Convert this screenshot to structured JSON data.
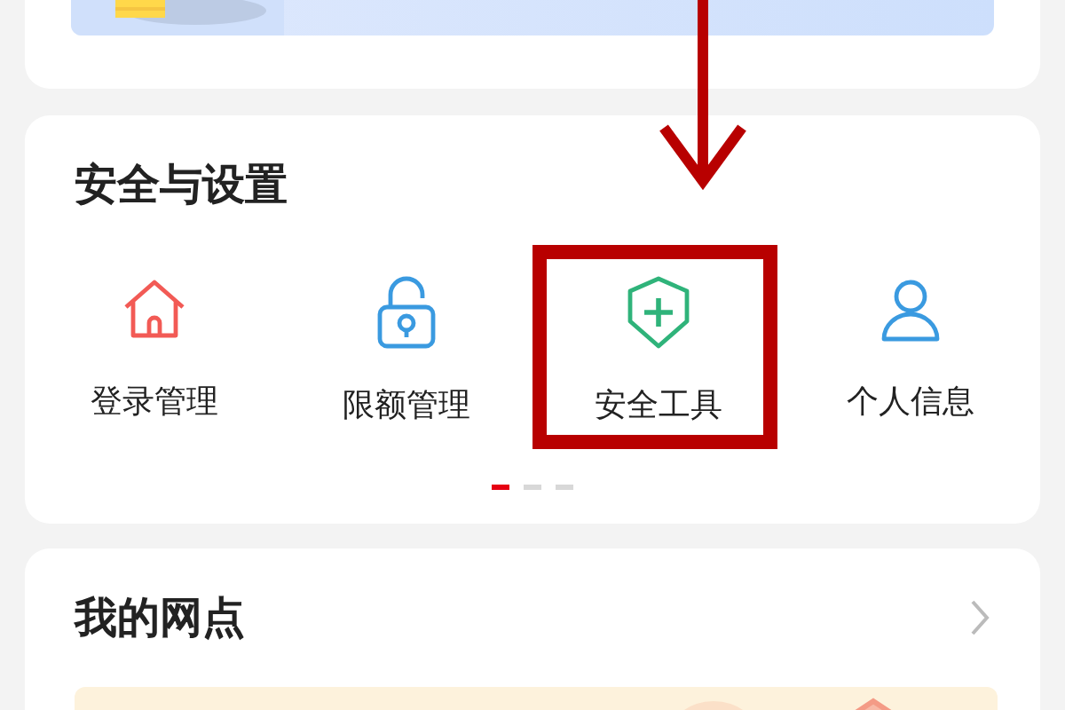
{
  "security_section": {
    "title": "安全与设置",
    "items": [
      {
        "label": "登录管理",
        "kind": "home",
        "highlighted": false
      },
      {
        "label": "限额管理",
        "kind": "lock",
        "highlighted": false
      },
      {
        "label": "安全工具",
        "kind": "shield",
        "highlighted": true
      },
      {
        "label": "个人信息",
        "kind": "user",
        "highlighted": false
      }
    ],
    "pages": [
      {
        "selected": true
      },
      {
        "selected": false
      },
      {
        "selected": false
      }
    ]
  },
  "outlets_section": {
    "title": "我的网点"
  }
}
